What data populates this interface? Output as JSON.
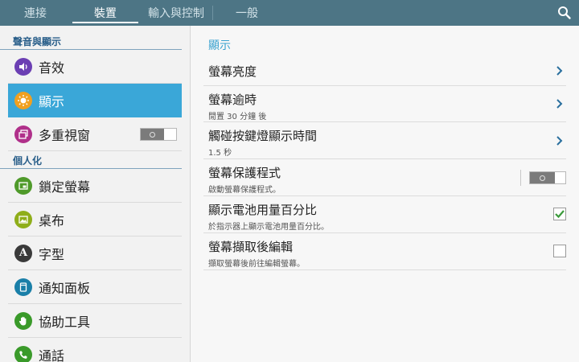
{
  "tabs": [
    {
      "label": "連接"
    },
    {
      "label": "裝置"
    },
    {
      "label": "輸入與控制"
    },
    {
      "label": "一般"
    }
  ],
  "colors": {
    "topbar": "#4d7585",
    "accent": "#3aa7d8",
    "section_header": "#2a5f8a",
    "checkbox_check": "#3a9a3a"
  },
  "sidebar": {
    "sections": [
      {
        "header": "聲音與顯示",
        "items": [
          {
            "label": "音效",
            "icon": "speaker-icon",
            "color": "#6b3fb3"
          },
          {
            "label": "顯示",
            "icon": "brightness-icon",
            "color": "#f0a020",
            "active": true
          },
          {
            "label": "多重視窗",
            "icon": "multi-window-icon",
            "color": "#b0308a",
            "toggle": "off"
          }
        ]
      },
      {
        "header": "個人化",
        "items": [
          {
            "label": "鎖定螢幕",
            "icon": "lock-screen-icon",
            "color": "#4f9a2a"
          },
          {
            "label": "桌布",
            "icon": "wallpaper-icon",
            "color": "#8fae1a"
          },
          {
            "label": "字型",
            "icon": "font-icon",
            "color": "#3a3a3a",
            "glyph": "A"
          },
          {
            "label": "通知面板",
            "icon": "notification-panel-icon",
            "color": "#1a7fa8"
          },
          {
            "label": "協助工具",
            "icon": "accessibility-hand-icon",
            "color": "#3a9a2a"
          },
          {
            "label": "通話",
            "icon": "phone-icon",
            "color": "#3a9a2a"
          }
        ]
      }
    ]
  },
  "content": {
    "title": "顯示",
    "rows": [
      {
        "title": "螢幕亮度",
        "subtitle": "",
        "control": "chevron"
      },
      {
        "title": "螢幕逾時",
        "subtitle": "閒置 30 分鐘 後",
        "control": "chevron"
      },
      {
        "title": "觸碰按鍵燈顯示時間",
        "subtitle": "1.5 秒",
        "control": "chevron"
      },
      {
        "title": "螢幕保護程式",
        "subtitle": "啟動螢幕保護程式。",
        "control": "toggle",
        "state": "off"
      },
      {
        "title": "顯示電池用量百分比",
        "subtitle": "於指示器上顯示電池用量百分比。",
        "control": "checkbox",
        "checked": true
      },
      {
        "title": "螢幕擷取後編輯",
        "subtitle": "擷取螢幕後前往編輯螢幕。",
        "control": "checkbox",
        "checked": false
      }
    ]
  }
}
